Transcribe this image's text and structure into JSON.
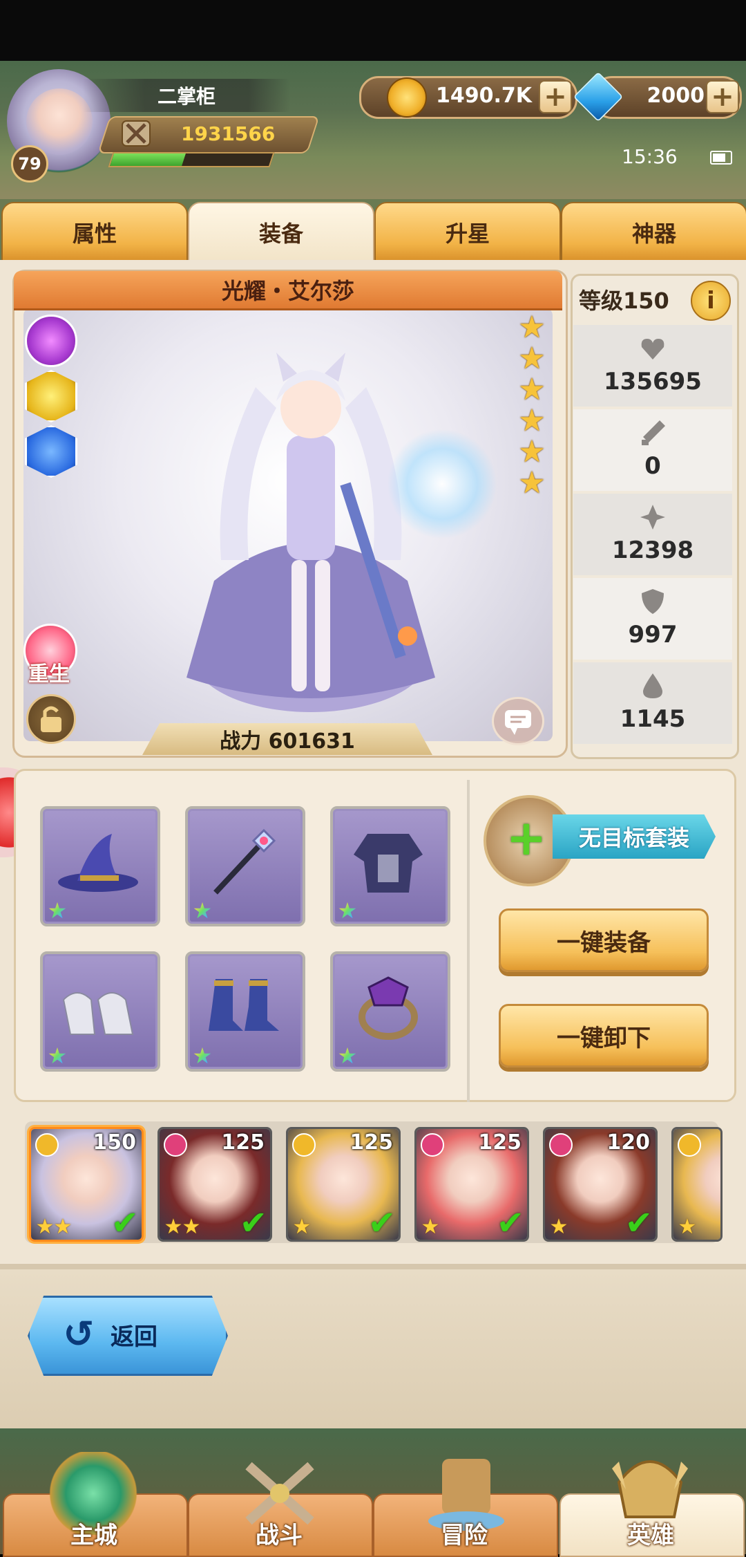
{
  "player": {
    "name": "二掌柜",
    "level": "79",
    "power": "1931566",
    "xp_fraction": 0.45
  },
  "currency": {
    "gold": "1490.7K",
    "gems": "2000",
    "plus_label": "+"
  },
  "status": {
    "time": "15:36"
  },
  "tabs": [
    {
      "label": "属性"
    },
    {
      "label": "装备"
    },
    {
      "label": "升星"
    },
    {
      "label": "神器"
    }
  ],
  "active_tab": "装备",
  "hero": {
    "name": "光耀・艾尔莎",
    "stars": 6,
    "star_glyph": "★",
    "rebirth_label": "重生",
    "power_text": "战力 601631"
  },
  "stats": {
    "level_text": "等级150",
    "info_label": "i",
    "rows": [
      {
        "icon": "heart-icon",
        "value": "135695"
      },
      {
        "icon": "sword-icon",
        "value": "0"
      },
      {
        "icon": "dagger-icon",
        "value": "12398"
      },
      {
        "icon": "shield-icon",
        "value": "997"
      },
      {
        "icon": "drop-icon",
        "value": "1145"
      }
    ]
  },
  "equipment": {
    "slots": [
      {
        "item": "wizard-hat-icon",
        "color": "#3a3a90"
      },
      {
        "item": "staff-icon",
        "color": "#4a4a6a"
      },
      {
        "item": "armor-icon",
        "color": "#3a3a6a"
      },
      {
        "item": "gloves-icon",
        "color": "#e6e6ee"
      },
      {
        "item": "boots-icon",
        "color": "#3a4aa0"
      },
      {
        "item": "ring-icon",
        "color": "#7a3ab0"
      }
    ],
    "suit_label": "无目标套装",
    "equip_all_label": "一键装备",
    "unequip_all_label": "一键卸下"
  },
  "roster": [
    {
      "level": "150",
      "badge_color": "#f0b82a",
      "stars": 2,
      "face": "#c9c2e0",
      "selected": true
    },
    {
      "level": "125",
      "badge_color": "#e0407a",
      "stars": 2,
      "face": "#7a2a2a",
      "selected": false
    },
    {
      "level": "125",
      "badge_color": "#f0b82a",
      "stars": 1,
      "face": "#e8b850",
      "selected": false
    },
    {
      "level": "125",
      "badge_color": "#e0407a",
      "stars": 1,
      "face": "#e86a6a",
      "selected": false
    },
    {
      "level": "120",
      "badge_color": "#e0407a",
      "stars": 1,
      "face": "#8a3a2a",
      "selected": false
    },
    {
      "level": "",
      "badge_color": "#f0b82a",
      "stars": 1,
      "face": "#e8b850",
      "selected": false
    }
  ],
  "back_label": "返回",
  "back_arrow": "↺",
  "nav": [
    {
      "label": "主城"
    },
    {
      "label": "战斗"
    },
    {
      "label": "冒险"
    },
    {
      "label": "英雄"
    }
  ],
  "active_nav": "英雄"
}
